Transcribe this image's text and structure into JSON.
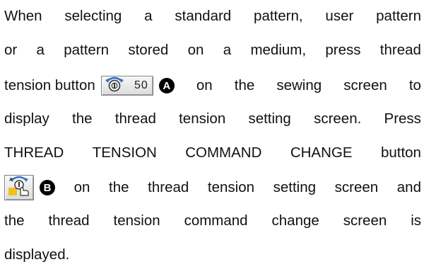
{
  "paragraph": {
    "line1": [
      "When",
      "selecting",
      "a",
      "standard",
      "pattern,",
      "user",
      "pattern"
    ],
    "line2": [
      "or",
      "a",
      "pattern",
      "stored",
      "on",
      "a",
      "medium,",
      "press",
      "thread"
    ],
    "line3_pre": "tension button",
    "tension_button_value": "50",
    "badge_a": "A",
    "line3_post": [
      "on",
      "the",
      "sewing",
      "screen",
      "to"
    ],
    "line4": [
      "display",
      "the",
      "thread",
      "tension",
      "setting",
      "screen.",
      "Press"
    ],
    "line5": [
      "THREAD",
      "TENSION",
      "COMMAND",
      "CHANGE",
      "button"
    ],
    "badge_b": "B",
    "line6_post": [
      "on",
      "the",
      "thread",
      "tension",
      "setting",
      "screen",
      "and"
    ],
    "line7": [
      "the",
      "thread",
      "tension",
      "command",
      "change",
      "screen",
      "is"
    ],
    "line8": "displayed."
  },
  "icons": {
    "tension_button_icon": "thread-tension-dial-icon",
    "command_change_icon": "thread-tension-command-change-icon"
  },
  "colors": {
    "text": "#111111",
    "button_face": "#e6e6e6",
    "icon_blue": "#2f6fc1",
    "icon_yellow": "#f0c020",
    "badge": "#000000"
  }
}
